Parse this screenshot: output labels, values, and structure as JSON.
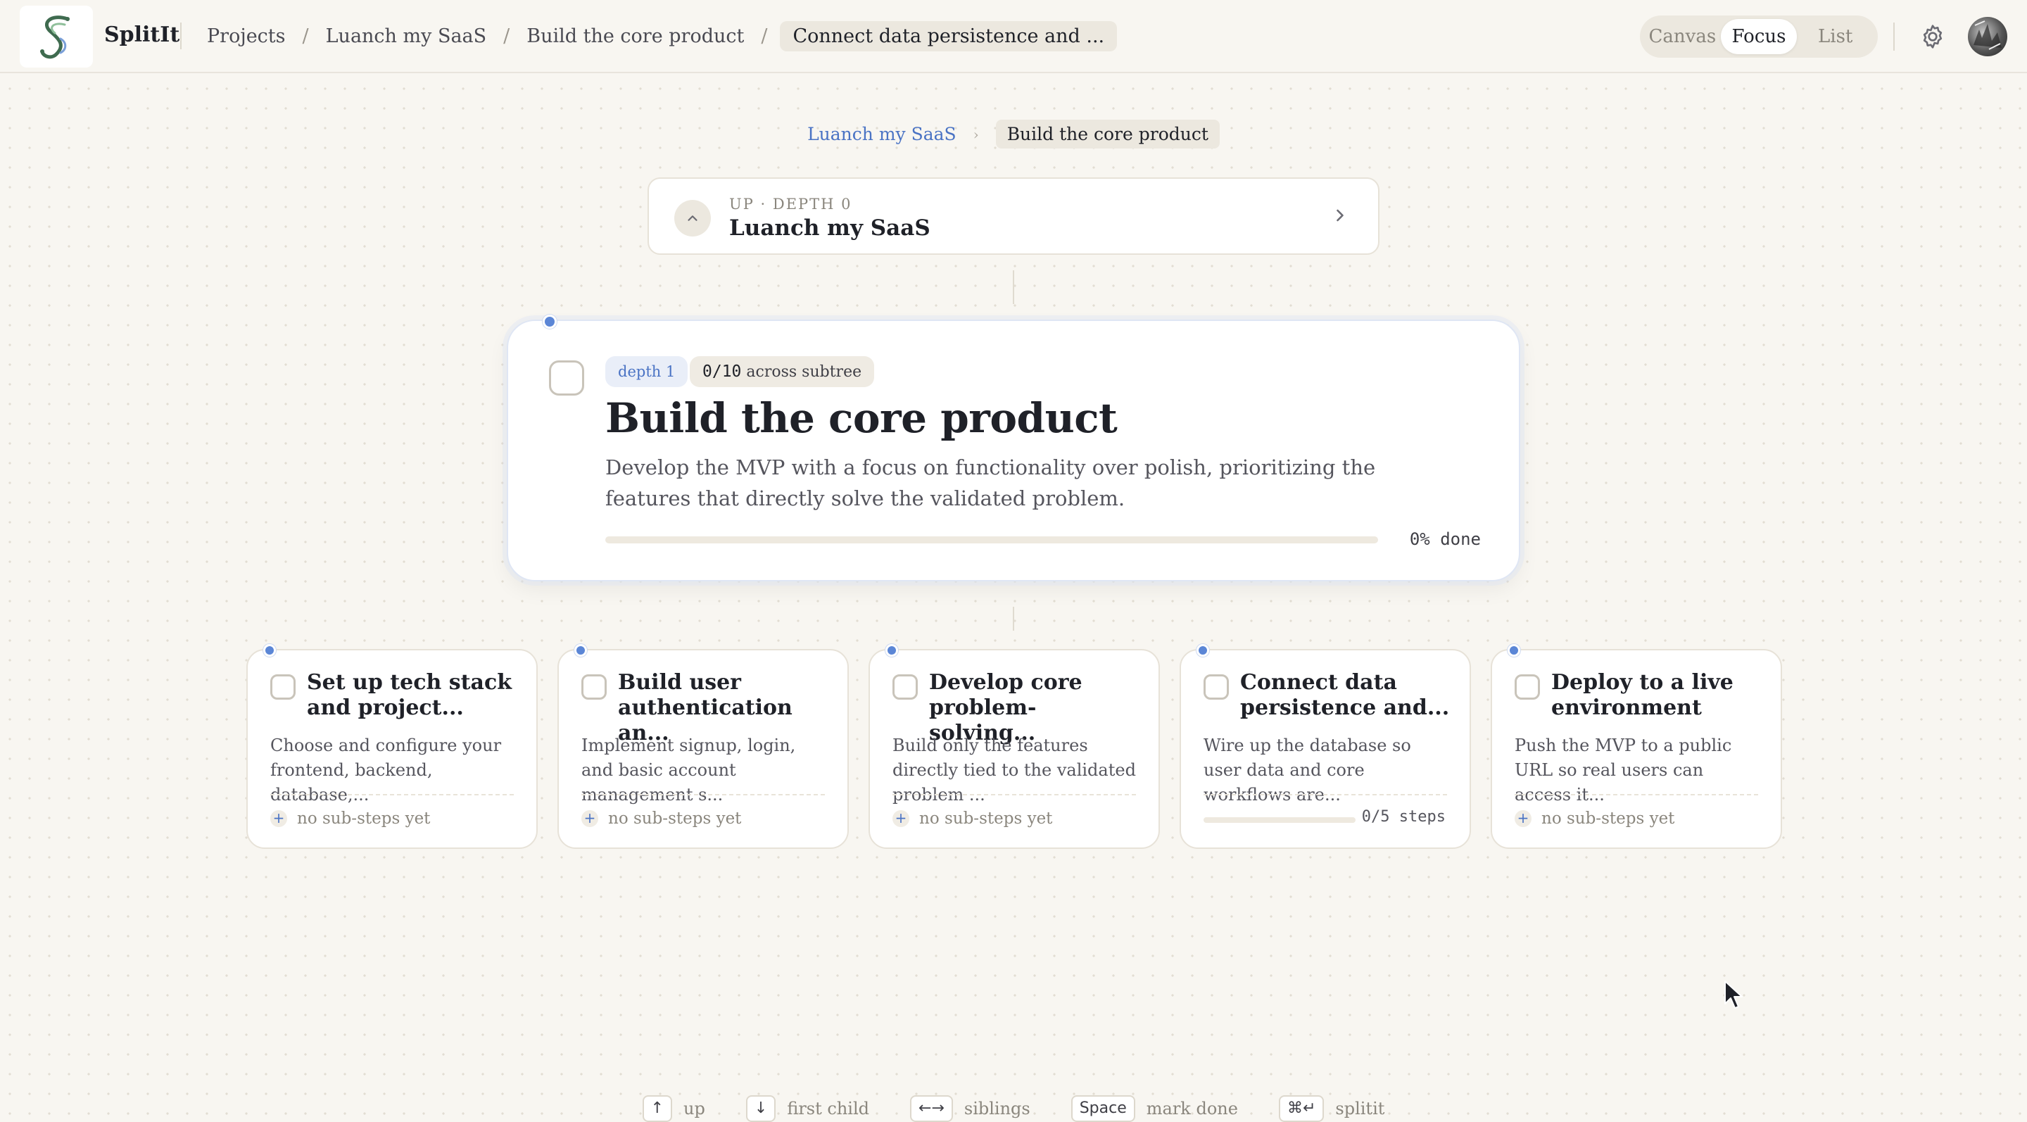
{
  "app": {
    "brand": "SplitIt"
  },
  "header": {
    "breadcrumbs": [
      "Projects",
      "Luanch my SaaS",
      "Build the core product"
    ],
    "current_crumb": "Connect data persistence and ...",
    "view_options": [
      "Canvas",
      "Focus",
      "List"
    ],
    "active_view": "Focus"
  },
  "focus_crumbs": {
    "parent": "Luanch my SaaS",
    "current": "Build the core product"
  },
  "up_card": {
    "eyebrow": "UP · DEPTH 0",
    "title": "Luanch my SaaS"
  },
  "main_node": {
    "depth_badge": "depth 1",
    "subtree_count": "0/10",
    "subtree_label": "across subtree",
    "title": "Build the core product",
    "description": "Develop the MVP with a focus on functionality over polish, prioritizing the features that directly solve the validated problem.",
    "progress_fraction": 0,
    "progress_label": "0% done"
  },
  "children": [
    {
      "title": "Set up tech stack and project...",
      "description": "Choose and configure your frontend, backend, database,...",
      "footer": "no sub-steps yet"
    },
    {
      "title": "Build user authentication an...",
      "description": "Implement signup, login, and basic account management s...",
      "footer": "no sub-steps yet"
    },
    {
      "title": "Develop core problem-solving...",
      "description": "Build only the features directly tied to the validated problem ...",
      "footer": "no sub-steps yet"
    },
    {
      "title": "Connect data persistence and...",
      "description": "Wire up the database so user data and core workflows are...",
      "steps_label": "0/5 steps",
      "steps_fraction": 0
    },
    {
      "title": "Deploy to a live environment",
      "description": "Push the MVP to a public URL so real users can access it...",
      "footer": "no sub-steps yet"
    }
  ],
  "hints": [
    {
      "key": "↑",
      "label": "up"
    },
    {
      "key": "↓",
      "label": "first child"
    },
    {
      "key": "←→",
      "label": "siblings"
    },
    {
      "key": "Space",
      "label": "mark done"
    },
    {
      "key": "⌘↵",
      "label": "splitit"
    }
  ],
  "colors": {
    "accent": "#5b86d6",
    "background": "#f8f6f1",
    "card": "#ffffff",
    "muted": "#8a867d"
  }
}
